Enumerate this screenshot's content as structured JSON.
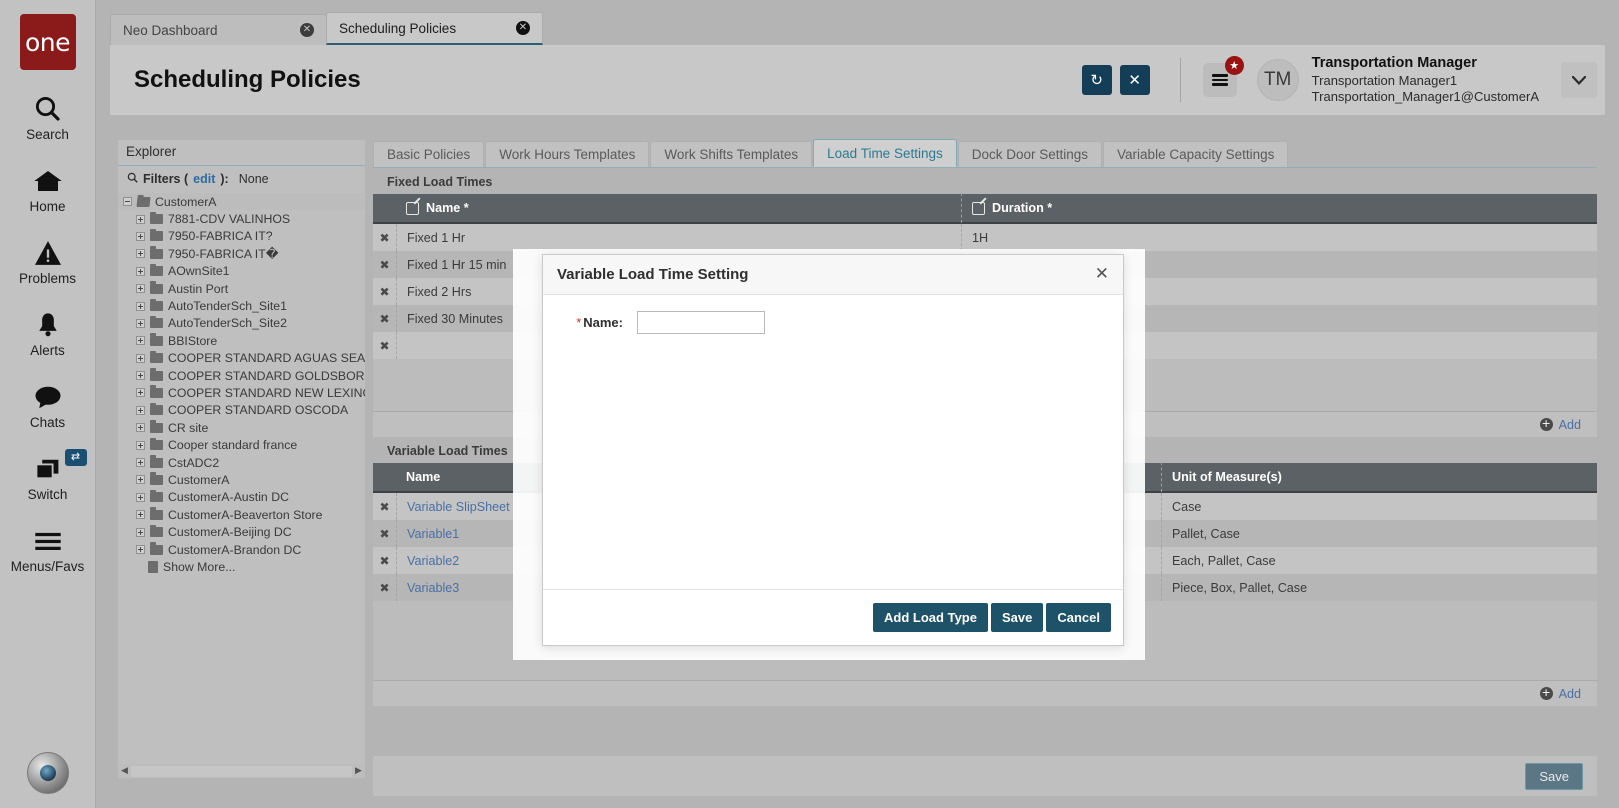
{
  "rail": {
    "logo_text": "one",
    "items": [
      {
        "label": "Search",
        "icon": "search-icon"
      },
      {
        "label": "Home",
        "icon": "home-icon"
      },
      {
        "label": "Problems",
        "icon": "warning-icon"
      },
      {
        "label": "Alerts",
        "icon": "bell-icon"
      },
      {
        "label": "Chats",
        "icon": "chat-icon"
      },
      {
        "label": "Switch",
        "icon": "switch-icon",
        "badge": "⇄"
      },
      {
        "label": "Menus/Favs",
        "icon": "hamburger-icon"
      }
    ]
  },
  "browser_tabs": [
    {
      "label": "Neo Dashboard",
      "active": false
    },
    {
      "label": "Scheduling Policies",
      "active": true
    }
  ],
  "header": {
    "title": "Scheduling Policies",
    "refresh_icon": "↻",
    "close_icon": "✕",
    "menu_badge": "★",
    "avatar_initials": "TM",
    "user_name": "Transportation Manager",
    "user_sub1": "Transportation Manager1",
    "user_sub2": "Transportation_Manager1@CustomerA",
    "caret_icon": "⌄"
  },
  "explorer": {
    "title": "Explorer",
    "filters_label": "Filters (",
    "filters_edit": "edit",
    "filters_label_end": "):",
    "filters_value": "None",
    "search_icon": "search-icon",
    "root": "CustomerA",
    "nodes": [
      "7881-CDV VALINHOS",
      "7950-FABRICA IT?",
      "7950-FABRICA IT�",
      "AOwnSite1",
      "Austin Port",
      "AutoTenderSch_Site1",
      "AutoTenderSch_Site2",
      "BBIStore",
      "COOPER STANDARD AGUAS SEALING (S",
      "COOPER STANDARD GOLDSBORO",
      "COOPER STANDARD NEW LEXINGTON",
      "COOPER STANDARD OSCODA",
      "CR site",
      "Cooper standard france",
      "CstADC2",
      "CustomerA",
      "CustomerA-Austin DC",
      "CustomerA-Beaverton Store",
      "CustomerA-Beijing DC",
      "CustomerA-Brandon DC"
    ],
    "show_more": "Show More..."
  },
  "tabs": [
    {
      "label": "Basic Policies",
      "active": false
    },
    {
      "label": "Work Hours Templates",
      "active": false
    },
    {
      "label": "Work Shifts Templates",
      "active": false
    },
    {
      "label": "Load Time Settings",
      "active": true
    },
    {
      "label": "Dock Door Settings",
      "active": false
    },
    {
      "label": "Variable Capacity Settings",
      "active": false
    }
  ],
  "fixed_load_times": {
    "section_title": "Fixed Load Times",
    "columns": [
      "Name *",
      "Duration *"
    ],
    "rows": [
      {
        "name": "Fixed 1 Hr",
        "duration": "1H"
      },
      {
        "name": "Fixed 1 Hr 15 min",
        "duration": ""
      },
      {
        "name": "Fixed 2 Hrs",
        "duration": ""
      },
      {
        "name": "Fixed 30 Minutes",
        "duration": ""
      },
      {
        "name": "",
        "duration": ""
      }
    ],
    "add_label": "Add"
  },
  "variable_load_times": {
    "section_title": "Variable Load Times",
    "columns": [
      "Name",
      "Unit of Measure(s)"
    ],
    "rows": [
      {
        "name": "Variable SlipSheet",
        "uom": "Case"
      },
      {
        "name": "Variable1",
        "uom": "Pallet, Case"
      },
      {
        "name": "Variable2",
        "uom": "Each, Pallet, Case"
      },
      {
        "name": "Variable3",
        "uom": "Piece, Box, Pallet, Case"
      }
    ],
    "add_label": "Add"
  },
  "footer": {
    "save_label": "Save"
  },
  "modal": {
    "title": "Variable Load Time Setting",
    "close_icon": "✕",
    "name_label": "Name:",
    "name_required": "*",
    "name_value": "",
    "name_placeholder": "",
    "buttons": {
      "add_load_type": "Add Load Type",
      "save": "Save",
      "cancel": "Cancel"
    }
  },
  "colors": {
    "accent_dark": "#143d57",
    "grid_header": "#5c6166",
    "link": "#4a6fa5",
    "active_tab": "#2b7a94",
    "brand_red": "#8b1a1a",
    "modal_button": "#1d5268"
  }
}
